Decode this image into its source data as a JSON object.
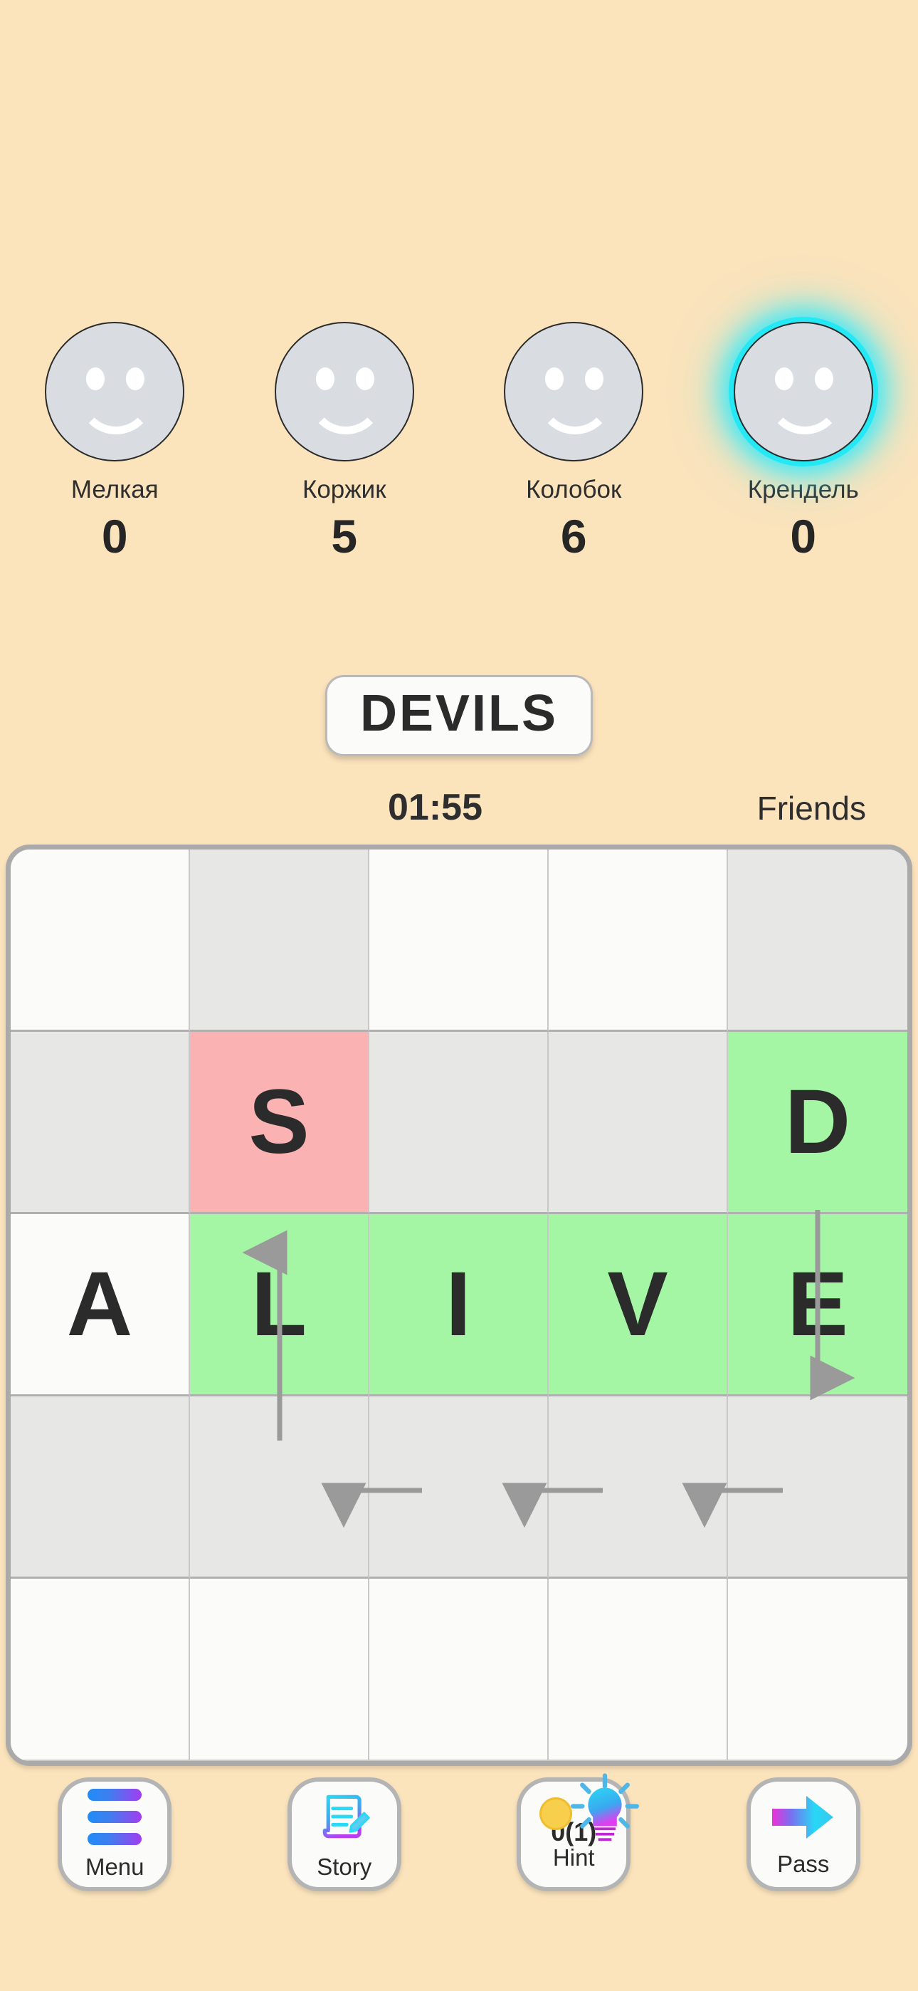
{
  "theme": {
    "background": "#fbe3bc",
    "active_glow": "#3fe9f7",
    "cell_green": "#a4f6a4",
    "cell_pink": "#fbb2b2",
    "cell_grey": "#e7e8e6",
    "cell_white": "#fbfbfa",
    "text_dark": "#2b2b2b"
  },
  "players": [
    {
      "name": "Мелкая",
      "score": "0",
      "active": false,
      "avatar_icon": "smiley-face-icon"
    },
    {
      "name": "Коржик",
      "score": "5",
      "active": false,
      "avatar_icon": "smiley-face-icon"
    },
    {
      "name": "Колобок",
      "score": "6",
      "active": false,
      "avatar_icon": "smiley-face-icon"
    },
    {
      "name": "Крендель",
      "score": "0",
      "active": true,
      "avatar_icon": "smiley-face-icon"
    }
  ],
  "word_banner": {
    "word": "DEVILS"
  },
  "meta": {
    "timer": "01:55",
    "mode": "Friends"
  },
  "board": {
    "rows": 5,
    "cols": 5,
    "cells": [
      [
        {
          "letter": "",
          "color": "white"
        },
        {
          "letter": "",
          "color": "grey"
        },
        {
          "letter": "",
          "color": "white"
        },
        {
          "letter": "",
          "color": "white"
        },
        {
          "letter": "",
          "color": "grey"
        }
      ],
      [
        {
          "letter": "",
          "color": "grey"
        },
        {
          "letter": "S",
          "color": "pink"
        },
        {
          "letter": "",
          "color": "grey"
        },
        {
          "letter": "",
          "color": "grey"
        },
        {
          "letter": "D",
          "color": "green"
        }
      ],
      [
        {
          "letter": "A",
          "color": "white"
        },
        {
          "letter": "L",
          "color": "green"
        },
        {
          "letter": "I",
          "color": "green"
        },
        {
          "letter": "V",
          "color": "green"
        },
        {
          "letter": "E",
          "color": "green"
        }
      ],
      [
        {
          "letter": "",
          "color": "grey"
        },
        {
          "letter": "",
          "color": "grey"
        },
        {
          "letter": "",
          "color": "grey"
        },
        {
          "letter": "",
          "color": "grey"
        },
        {
          "letter": "",
          "color": "grey"
        }
      ],
      [
        {
          "letter": "",
          "color": "white"
        },
        {
          "letter": "",
          "color": "white"
        },
        {
          "letter": "",
          "color": "white"
        },
        {
          "letter": "",
          "color": "white"
        },
        {
          "letter": "",
          "color": "white"
        }
      ]
    ],
    "arrows": [
      {
        "name": "arrow-up-from-L-to-S",
        "direction": "up",
        "from": "r3c2",
        "to": "r2c2"
      },
      {
        "name": "arrow-down-from-D-to-E",
        "direction": "down",
        "from": "r2c5",
        "to": "r3c5"
      },
      {
        "name": "arrow-left-E-to-V",
        "direction": "left",
        "from": "r3c5",
        "to": "r3c4"
      },
      {
        "name": "arrow-left-V-to-I",
        "direction": "left",
        "from": "r3c4",
        "to": "r3c3"
      },
      {
        "name": "arrow-left-I-to-L",
        "direction": "left",
        "from": "r3c3",
        "to": "r3c2"
      }
    ]
  },
  "toolbar": [
    {
      "label": "Menu",
      "icon": "hamburger-menu-icon",
      "count": ""
    },
    {
      "label": "Story",
      "icon": "document-pencil-icon",
      "count": ""
    },
    {
      "label": "Hint",
      "icon": "lightbulb-icon",
      "count": "0(1)",
      "coin_icon": "coin-icon"
    },
    {
      "label": "Pass",
      "icon": "arrow-right-icon",
      "count": ""
    }
  ]
}
